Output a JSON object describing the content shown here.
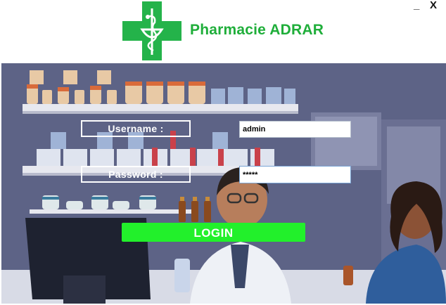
{
  "window": {
    "minimize_label": "_",
    "close_label": "X"
  },
  "header": {
    "brand_name": "Pharmacie ADRAR",
    "brand_color": "#1fae3a",
    "logo_icon": "pharmacy-cross-icon"
  },
  "login_form": {
    "username_label": "Username :",
    "username_value": "admin",
    "password_label": "Password :",
    "password_value": "*****",
    "login_button_label": "LOGIN",
    "login_button_color": "#22f02b"
  },
  "background": {
    "scene": "pharmacy-interior-illustration"
  }
}
